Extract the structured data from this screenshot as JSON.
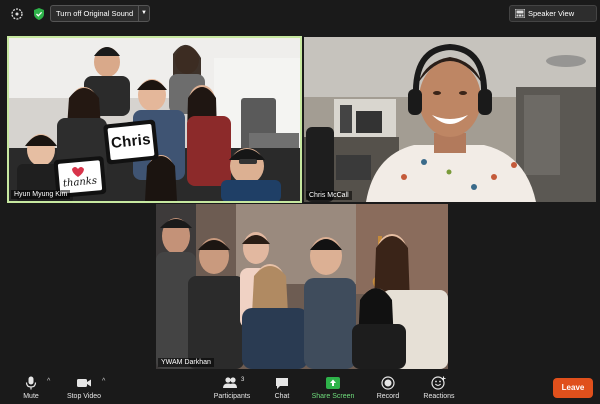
{
  "topbar": {
    "original_sound_label": "Turn off Original Sound",
    "view_label": "Speaker View"
  },
  "tiles": {
    "top_left": {
      "name": "Hyun Myung Kim",
      "sign_chris": "Chris",
      "sign_thanks": "thanks"
    },
    "top_right": {
      "name": "Chris McCall"
    },
    "bottom": {
      "name": "YWAM Darkhan"
    }
  },
  "toolbar": {
    "mute": "Mute",
    "stop_video": "Stop Video",
    "participants": "Participants",
    "participants_count": "3",
    "chat": "Chat",
    "share_screen": "Share Screen",
    "record": "Record",
    "reactions": "Reactions",
    "leave": "Leave"
  },
  "colors": {
    "active_speaker_border": "#c7e8a0",
    "share_green": "#2eb34a",
    "leave": "#e0501c"
  }
}
